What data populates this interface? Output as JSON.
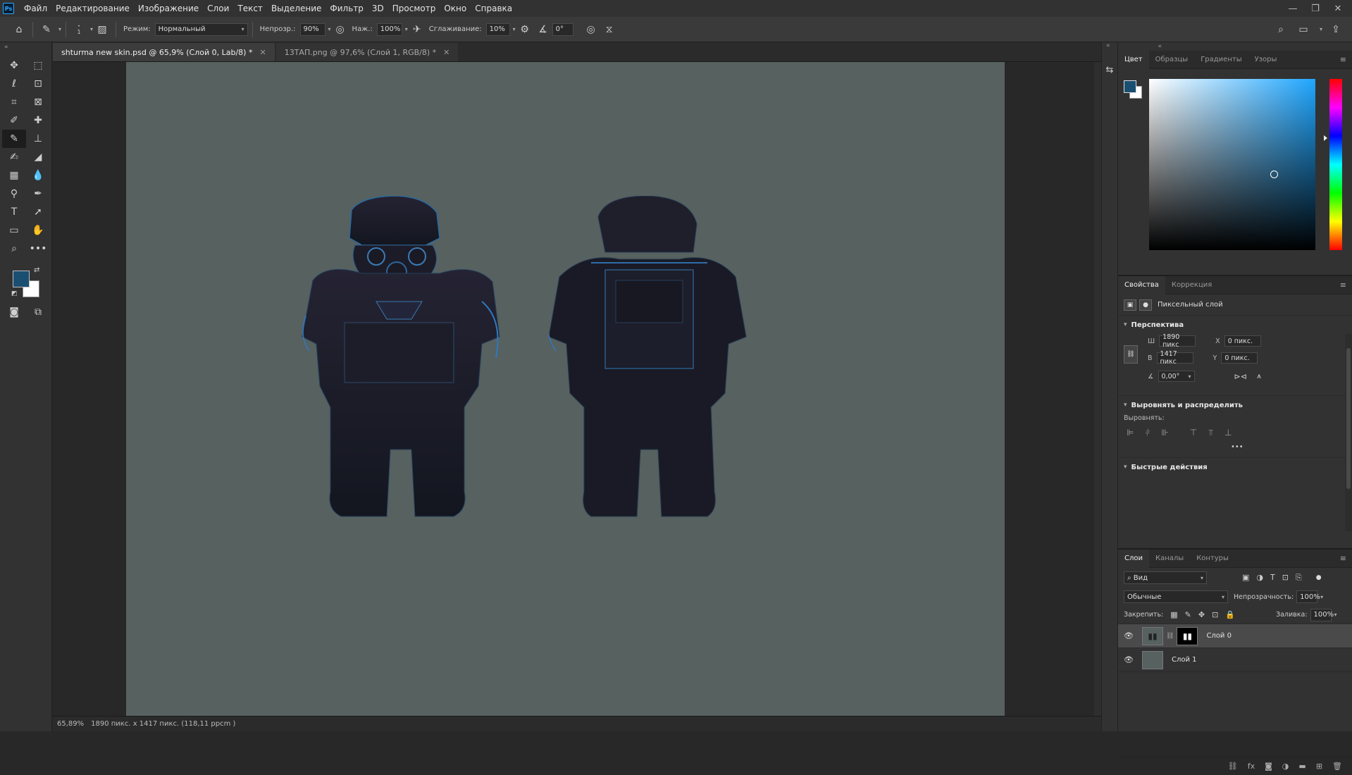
{
  "app": {
    "logo": "Ps"
  },
  "menu": [
    "Файл",
    "Редактирование",
    "Изображение",
    "Слои",
    "Текст",
    "Выделение",
    "Фильтр",
    "3D",
    "Просмотр",
    "Окно",
    "Справка"
  ],
  "window_controls": {
    "minimize": "—",
    "restore": "❐",
    "close": "✕"
  },
  "options_bar": {
    "brush_size": "1",
    "mode_label": "Режим:",
    "mode_value": "Нормальный",
    "opacity_label": "Непрозр.:",
    "opacity_value": "90%",
    "pressure_label": "Наж.:",
    "pressure_value": "100%",
    "smoothing_label": "Сглаживание:",
    "smoothing_value": "10%",
    "angle_value": "0°"
  },
  "tabs": [
    {
      "label": "shturma new skin.psd @ 65,9% (Слой 0, Lab/8) *",
      "active": true
    },
    {
      "label": "13ТАП.png @ 97,6% (Слой 1, RGB/8) *",
      "active": false
    }
  ],
  "status": {
    "zoom": "65,89%",
    "info": "1890 пикс. x 1417 пикс. (118,11 ppcm )"
  },
  "colors": {
    "foreground": "#1b4f72",
    "background": "#ffffff",
    "canvas": "#566160",
    "accent": "#31a8ff"
  },
  "color_panel": {
    "tabs": [
      "Цвет",
      "Образцы",
      "Градиенты",
      "Узоры"
    ]
  },
  "properties_panel": {
    "tabs": [
      "Свойства",
      "Коррекция"
    ],
    "layer_type": "Пиксельный слой",
    "perspective_title": "Перспектива",
    "w_label": "Ш",
    "w_value": "1890 пикс",
    "h_label": "В",
    "h_value": "1417 пикс",
    "x_label": "X",
    "x_value": "0 пикс.",
    "y_label": "Y",
    "y_value": "0 пикс.",
    "angle_value": "0,00°",
    "align_title": "Выровнять и распределить",
    "align_label": "Выровнять:",
    "more": "•••",
    "quick_title": "Быстрые действия"
  },
  "layers_panel": {
    "tabs": [
      "Слои",
      "Каналы",
      "Контуры"
    ],
    "filter_value": "Вид",
    "blend_mode": "Обычные",
    "opacity_label": "Непрозрачность:",
    "opacity_value": "100%",
    "lock_label": "Закрепить:",
    "fill_label": "Заливка:",
    "fill_value": "100%",
    "layers": [
      {
        "name": "Слой 0",
        "active": true
      },
      {
        "name": "Слой 1",
        "active": false
      }
    ]
  }
}
